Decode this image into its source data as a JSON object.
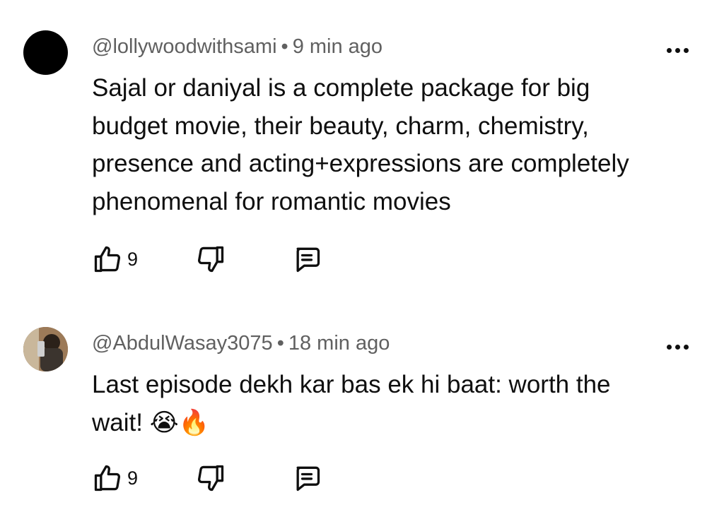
{
  "comments": [
    {
      "handle": "@lollywoodwithsami",
      "time": "9 min ago",
      "separator": "•",
      "text_lines": [
        "Sajal or daniyal is a complete package for big",
        "budget movie, their beauty, charm, chemistry,",
        "presence and acting+expressions are completely",
        "phenomenal for romantic movies"
      ],
      "likes": "9"
    },
    {
      "handle": "@AbdulWasay3075",
      "time": "18 min ago",
      "separator": "•",
      "text_lines": [
        "Last episode dekh kar bas ek hi baat: worth the",
        "wait! 😭🔥"
      ],
      "likes": "9"
    }
  ],
  "icons": {
    "like": "thumbs-up-icon",
    "dislike": "thumbs-down-icon",
    "reply": "reply-comment-icon",
    "more": "more-options-icon"
  }
}
